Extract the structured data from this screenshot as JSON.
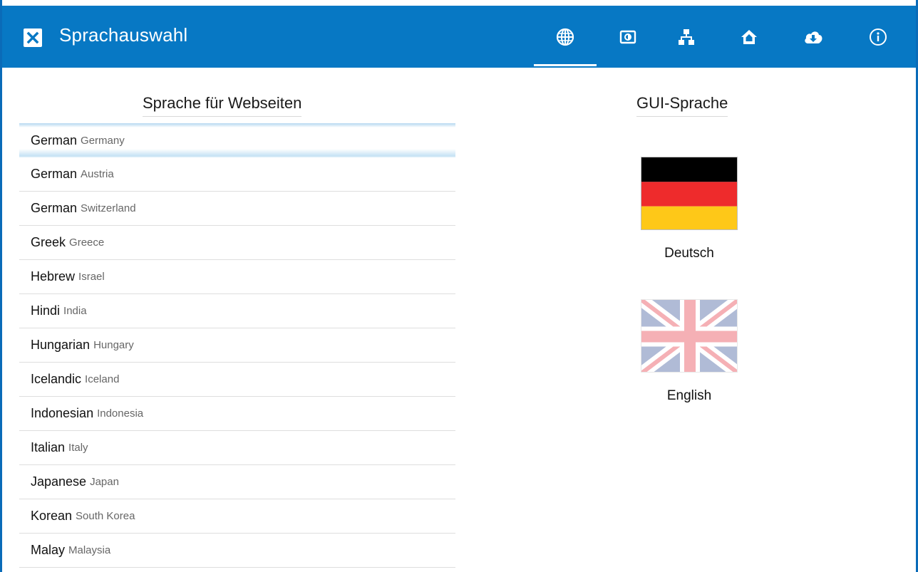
{
  "header": {
    "title": "Sprachauswahl",
    "close_icon": "close-icon",
    "nav_icons": [
      {
        "name": "globe-icon",
        "active": true
      },
      {
        "name": "display-icon",
        "active": false
      },
      {
        "name": "network-icon",
        "active": false
      },
      {
        "name": "home-icon",
        "active": false
      },
      {
        "name": "cloud-download-icon",
        "active": false
      },
      {
        "name": "info-icon",
        "active": false
      }
    ],
    "colors": {
      "bar": "#0778c4",
      "icon": "#ffffff"
    }
  },
  "web_language": {
    "title": "Sprache für Webseiten",
    "items": [
      {
        "name": "German",
        "region": "Germany",
        "selected": true
      },
      {
        "name": "German",
        "region": "Austria",
        "selected": false
      },
      {
        "name": "German",
        "region": "Switzerland",
        "selected": false
      },
      {
        "name": "Greek",
        "region": "Greece",
        "selected": false
      },
      {
        "name": "Hebrew",
        "region": "Israel",
        "selected": false
      },
      {
        "name": "Hindi",
        "region": "India",
        "selected": false
      },
      {
        "name": "Hungarian",
        "region": "Hungary",
        "selected": false
      },
      {
        "name": "Icelandic",
        "region": "Iceland",
        "selected": false
      },
      {
        "name": "Indonesian",
        "region": "Indonesia",
        "selected": false
      },
      {
        "name": "Italian",
        "region": "Italy",
        "selected": false
      },
      {
        "name": "Japanese",
        "region": "Japan",
        "selected": false
      },
      {
        "name": "Korean",
        "region": "South Korea",
        "selected": false
      },
      {
        "name": "Malay",
        "region": "Malaysia",
        "selected": false
      }
    ]
  },
  "gui_language": {
    "title": "GUI-Sprache",
    "options": [
      {
        "label": "Deutsch",
        "flag": "germany-flag-icon",
        "selected": true
      },
      {
        "label": "English",
        "flag": "uk-flag-icon",
        "selected": false
      }
    ]
  }
}
